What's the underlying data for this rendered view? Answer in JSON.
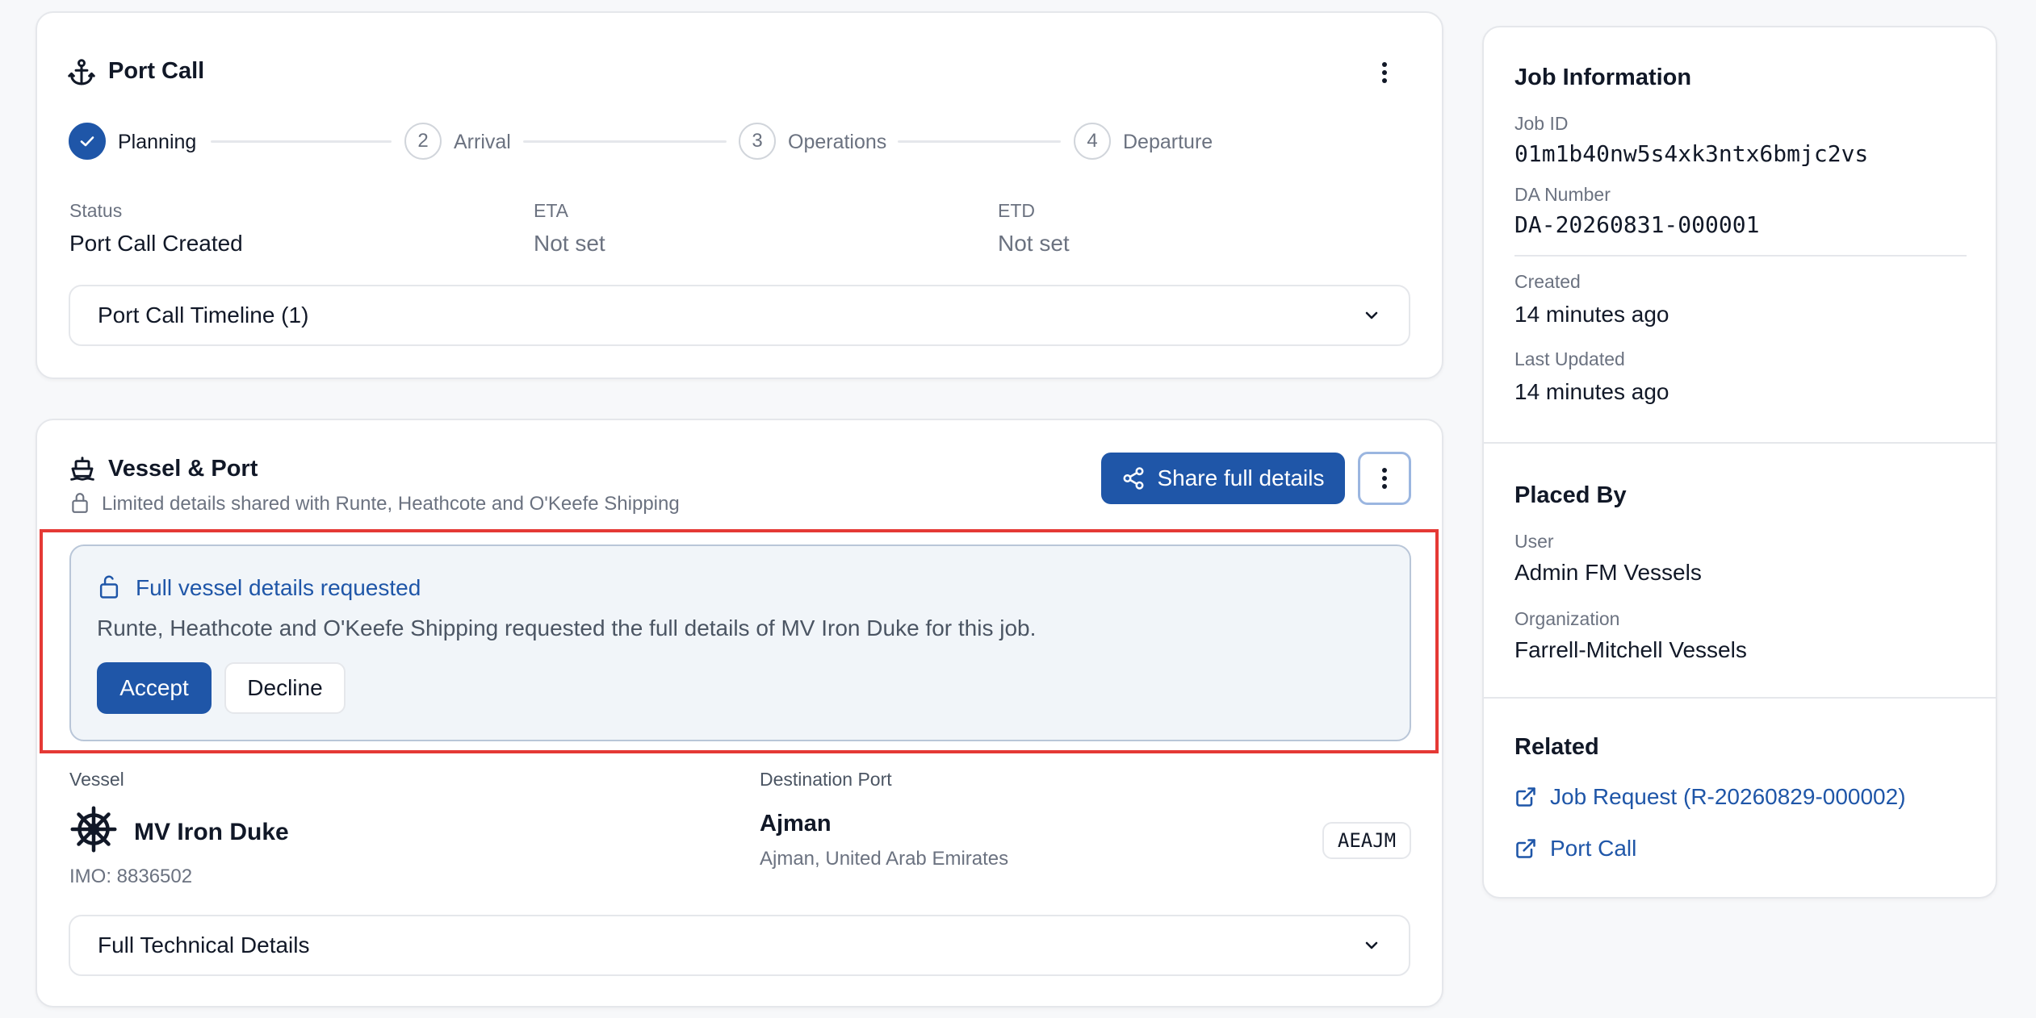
{
  "port_call": {
    "title": "Port Call",
    "steps": [
      {
        "label": "Planning",
        "number": "",
        "status": "done"
      },
      {
        "label": "Arrival",
        "number": "2",
        "status": "pending"
      },
      {
        "label": "Operations",
        "number": "3",
        "status": "pending"
      },
      {
        "label": "Departure",
        "number": "4",
        "status": "pending"
      }
    ],
    "fields": [
      {
        "label": "Status",
        "value": "Port Call Created"
      },
      {
        "label": "ETA",
        "value": "Not set"
      },
      {
        "label": "ETD",
        "value": "Not set"
      }
    ],
    "timeline_label": "Port Call Timeline (1)"
  },
  "vessel_port": {
    "title": "Vessel & Port",
    "share_note": "Limited details shared with Runte, Heathcote and O'Keefe Shipping",
    "share_button": "Share full details",
    "request": {
      "title": "Full vessel details requested",
      "message": "Runte, Heathcote and O'Keefe Shipping requested the full details of MV Iron Duke for this job.",
      "accept": "Accept",
      "decline": "Decline"
    },
    "vessel": {
      "label": "Vessel",
      "name": "MV Iron Duke",
      "imo": "IMO: 8836502"
    },
    "destination": {
      "label": "Destination Port",
      "name": "Ajman",
      "location": "Ajman, United Arab Emirates",
      "code": "AEAJM"
    },
    "technical_label": "Full Technical Details"
  },
  "sidebar": {
    "job_info": {
      "title": "Job Information",
      "job_id_label": "Job ID",
      "job_id": "01m1b40nw5s4xk3ntx6bmjc2vs",
      "da_label": "DA Number",
      "da_number": "DA-20260831-000001",
      "created_label": "Created",
      "created": "14 minutes ago",
      "updated_label": "Last Updated",
      "updated": "14 minutes ago"
    },
    "placed_by": {
      "title": "Placed By",
      "user_label": "User",
      "user": "Admin FM Vessels",
      "org_label": "Organization",
      "org": "Farrell-Mitchell Vessels"
    },
    "related": {
      "title": "Related",
      "links": [
        "Job Request (R-20260829-000002)",
        "Port Call"
      ]
    }
  },
  "colors": {
    "primary": "#1f56a8",
    "highlight_border": "#e53935",
    "request_bg": "#f1f5f9"
  }
}
